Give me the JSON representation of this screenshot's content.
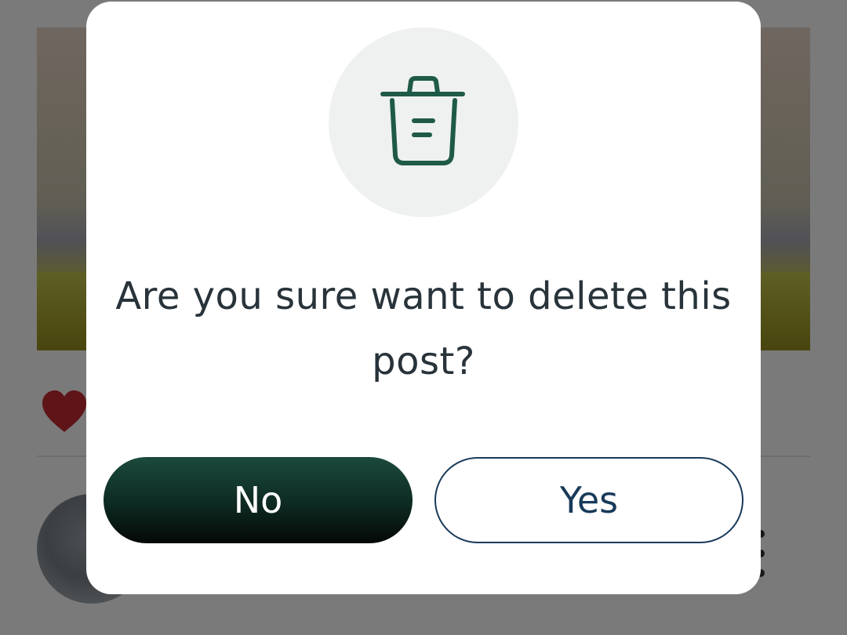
{
  "dialog": {
    "message": "Are you sure want to delete this post?",
    "icon": "trash-icon",
    "no_label": "No",
    "yes_label": "Yes"
  },
  "background": {
    "like_icon": "heart-icon",
    "menu_icon": "more-vertical-icon"
  },
  "colors": {
    "primary_dark_green": "#1b4a3c",
    "icon_green": "#1f5a48",
    "icon_circle_bg": "#eef1ef",
    "yes_border": "#183a5a",
    "text_dark": "#28333a",
    "heart_red": "#c62a33"
  }
}
